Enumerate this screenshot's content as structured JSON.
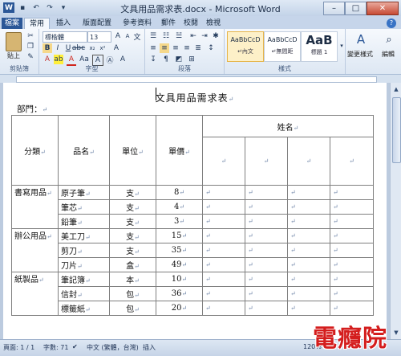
{
  "window": {
    "title": "文具用品需求表.docx - Microsoft Word"
  },
  "tabs": [
    "檔案",
    "常用",
    "插入",
    "版面配置",
    "參考資料",
    "郵件",
    "校閱",
    "檢視"
  ],
  "ribbon": {
    "font_name": "標楷體",
    "font_size": "13",
    "paste_label": "貼上",
    "groups": {
      "clipboard": "剪貼簿",
      "font": "字型",
      "paragraph": "段落",
      "styles": "樣式"
    },
    "styles": [
      {
        "preview": "AaBbCcD",
        "name": "↵內文"
      },
      {
        "preview": "AaBbCcD",
        "name": "↵無間距"
      },
      {
        "preview": "AaB",
        "name": "標題 1"
      }
    ],
    "change_styles": "變更樣式",
    "edit": "編輯"
  },
  "document": {
    "title": "文具用品需求表",
    "department": "部門：",
    "table": {
      "headers": [
        "分類",
        "品名",
        "單位",
        "單價",
        "姓名"
      ],
      "rows": [
        {
          "category": "書寫用品",
          "item": "原子筆",
          "unit": "支",
          "price": "8"
        },
        {
          "category": "",
          "item": "筆芯",
          "unit": "支",
          "price": "4"
        },
        {
          "category": "",
          "item": "鉛筆",
          "unit": "支",
          "price": "3"
        },
        {
          "category": "辦公用品",
          "item": "美工刀",
          "unit": "支",
          "price": "15"
        },
        {
          "category": "",
          "item": "剪刀",
          "unit": "支",
          "price": "35"
        },
        {
          "category": "",
          "item": "刀片",
          "unit": "盒",
          "price": "49"
        },
        {
          "category": "紙製品",
          "item": "筆記簿",
          "unit": "本",
          "price": "10"
        },
        {
          "category": "",
          "item": "信封",
          "unit": "包",
          "price": "36"
        },
        {
          "category": "",
          "item": "標籤紙",
          "unit": "包",
          "price": "20"
        }
      ]
    }
  },
  "status": {
    "page": "頁面: 1 / 1",
    "words": "字數: 71",
    "language": "中文 (繁體，台灣)",
    "mode": "插入",
    "zoom": "120%"
  },
  "watermark": "電癮院"
}
